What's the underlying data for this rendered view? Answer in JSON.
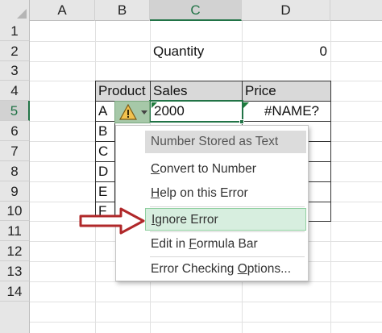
{
  "columns": [
    "A",
    "B",
    "C",
    "D"
  ],
  "selected_column": "C",
  "rows": [
    "1",
    "2",
    "3",
    "4",
    "5",
    "6",
    "7",
    "8",
    "9",
    "10",
    "11",
    "12",
    "13",
    "14"
  ],
  "selected_row": "5",
  "cells": {
    "quantity_label": "Quantity",
    "quantity_value": "0",
    "header_product": "Product",
    "header_sales": "Sales",
    "header_price": "Price",
    "products": [
      "A",
      "B",
      "C",
      "D",
      "E",
      "F"
    ],
    "sales_a": "2000",
    "price_a": "#NAME?"
  },
  "error_menu": {
    "header": "Number Stored as Text",
    "items": [
      {
        "label": "Convert to Number",
        "accel": "C",
        "rest": "onvert to Number"
      },
      {
        "label": "Help on this Error",
        "accel": "H",
        "rest": "elp on this Error"
      },
      {
        "label": "Ignore Error",
        "accel": "I",
        "rest": "gnore Error"
      },
      {
        "label": "Edit in Formula Bar",
        "pre": "Edit in ",
        "accel": "F",
        "rest": "ormula Bar"
      },
      {
        "label": "Error Checking Options...",
        "pre": "Error Checking ",
        "accel": "O",
        "rest": "ptions..."
      }
    ]
  },
  "colors": {
    "accent_green": "#217346",
    "arrow_red": "#b0282a",
    "warning_yellow": "#f2c24f"
  },
  "icons": {
    "error_button": "warning-triangle-icon",
    "pointer": "red-arrow-icon"
  }
}
